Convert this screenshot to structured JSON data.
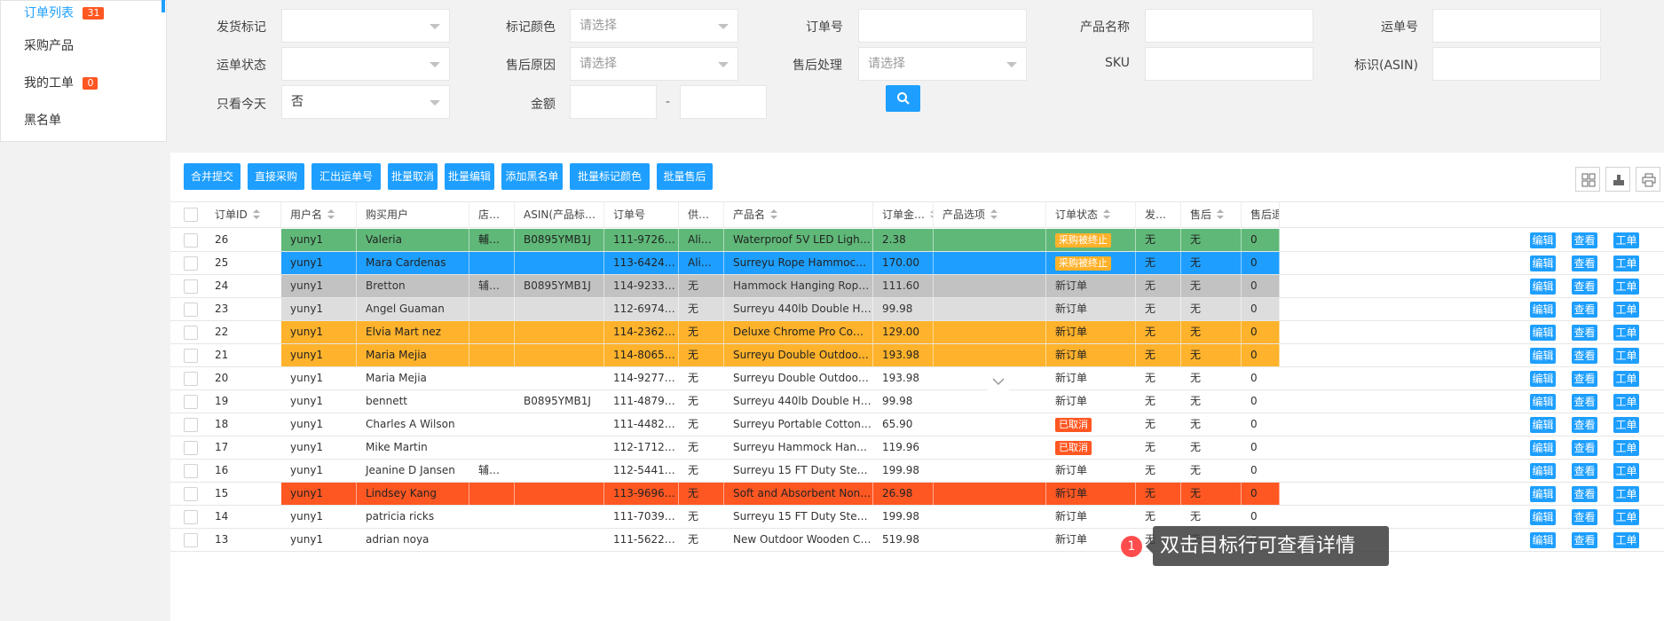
{
  "sidebar": {
    "items": [
      {
        "label": "订单列表",
        "badge": "31"
      },
      {
        "label": "采购产品",
        "badge": ""
      },
      {
        "label": "我的工单",
        "badge": "0"
      },
      {
        "label": "黑名单",
        "badge": ""
      }
    ]
  },
  "filters": {
    "ship_mark": {
      "label": "发货标记",
      "value": ""
    },
    "mark_color": {
      "label": "标记颜色",
      "placeholder": "请选择"
    },
    "order_no": {
      "label": "订单号",
      "value": ""
    },
    "product_name": {
      "label": "产品名称",
      "value": ""
    },
    "tracking_no": {
      "label": "运单号",
      "value": ""
    },
    "ship_status": {
      "label": "运单状态",
      "value": ""
    },
    "aftersale_reason": {
      "label": "售后原因",
      "placeholder": "请选择"
    },
    "aftersale_handling": {
      "label": "售后处理",
      "placeholder": "请选择"
    },
    "sku": {
      "label": "SKU",
      "value": ""
    },
    "asin": {
      "label": "标识(ASIN)",
      "value": ""
    },
    "today_only": {
      "label": "只看今天",
      "value": "否"
    },
    "amount": {
      "label": "金额",
      "separator": "-"
    }
  },
  "toolbar": {
    "buttons": [
      "合并提交",
      "直接采购",
      "汇出运单号",
      "批量取消",
      "批量编辑",
      "添加黑名单",
      "批量标记颜色",
      "批量售后"
    ]
  },
  "table": {
    "headers": [
      "订单ID",
      "用户名",
      "购买用户",
      "店…",
      "ASIN(产品标…",
      "订单号",
      "供…",
      "产品名",
      "订单金…",
      "产品选项",
      "订单状态",
      "发…",
      "售后",
      "售后退"
    ],
    "action_labels": [
      "编辑",
      "查看",
      "工单"
    ],
    "rows": [
      {
        "id": "26",
        "user": "yuny1",
        "buyer": "Valeria",
        "store": "輔…",
        "asin": "B0895YMB1J",
        "order_no": "111-97267…",
        "supplier": "Ali…",
        "product": "Waterproof 5V LED Light Stri…",
        "amount": "2.38",
        "options": "",
        "status": "采购被终止",
        "ship": "无",
        "aftersale": "无",
        "refund": "0"
      },
      {
        "id": "25",
        "user": "yuny1",
        "buyer": "Mara Cardenas",
        "store": "",
        "asin": "",
        "order_no": "113-64246…",
        "supplier": "Ali…",
        "product": "Surreyu Rope Hammock 55\" …",
        "amount": "170.00",
        "options": "",
        "status": "采购被终止",
        "ship": "无",
        "aftersale": "无",
        "refund": "0"
      },
      {
        "id": "24",
        "user": "yuny1",
        "buyer": "Bretton",
        "store": "辅…",
        "asin": "B0895YMB1J",
        "order_no": "114-92335…",
        "supplier": "无",
        "product": "Hammock Hanging Rope Ch…",
        "amount": "111.60",
        "options": "",
        "status": "新订单",
        "ship": "无",
        "aftersale": "无",
        "refund": "0"
      },
      {
        "id": "23",
        "user": "yuny1",
        "buyer": "Angel Guaman",
        "store": "",
        "asin": "",
        "order_no": "112-69749…",
        "supplier": "无",
        "product": "Surreyu 440lb Double Hamm…",
        "amount": "99.98",
        "options": "",
        "status": "新订单",
        "ship": "无",
        "aftersale": "无",
        "refund": "0"
      },
      {
        "id": "22",
        "user": "yuny1",
        "buyer": "Elvia Mart nez",
        "store": "",
        "asin": "",
        "order_no": "114-23624…",
        "supplier": "无",
        "product": "Deluxe Chrome Pro Complet…",
        "amount": "129.00",
        "options": "",
        "status": "新订单",
        "ship": "无",
        "aftersale": "无",
        "refund": "0"
      },
      {
        "id": "21",
        "user": "yuny1",
        "buyer": "Maria Mejia",
        "store": "",
        "asin": "",
        "order_no": "114-80652…",
        "supplier": "无",
        "product": "Surreyu Double Outdoor Swi…",
        "amount": "193.98",
        "options": "",
        "status": "新订单",
        "ship": "无",
        "aftersale": "无",
        "refund": "0"
      },
      {
        "id": "20",
        "user": "yuny1",
        "buyer": "Maria Mejia",
        "store": "",
        "asin": "",
        "order_no": "114-92772…",
        "supplier": "无",
        "product": "Surreyu Double Outdoor Swi…",
        "amount": "193.98",
        "options": "",
        "status": "新订单",
        "ship": "无",
        "aftersale": "无",
        "refund": "0"
      },
      {
        "id": "19",
        "user": "yuny1",
        "buyer": "bennett",
        "store": "",
        "asin": "B0895YMB1J",
        "order_no": "111-48797…",
        "supplier": "无",
        "product": "Surreyu 440lb Double Hamm…",
        "amount": "99.98",
        "options": "",
        "status": "新订单",
        "ship": "无",
        "aftersale": "无",
        "refund": "0"
      },
      {
        "id": "18",
        "user": "yuny1",
        "buyer": "Charles A Wilson",
        "store": "",
        "asin": "",
        "order_no": "111-44828…",
        "supplier": "无",
        "product": "Surreyu Portable Cotton Rop…",
        "amount": "65.90",
        "options": "",
        "status": "已取消",
        "ship": "无",
        "aftersale": "无",
        "refund": "0"
      },
      {
        "id": "17",
        "user": "yuny1",
        "buyer": "Mike Martin",
        "store": "",
        "asin": "",
        "order_no": "112-17125…",
        "supplier": "无",
        "product": "Surreyu Hammock Hanging …",
        "amount": "119.96",
        "options": "",
        "status": "已取消",
        "ship": "无",
        "aftersale": "无",
        "refund": "0"
      },
      {
        "id": "16",
        "user": "yuny1",
        "buyer": "Jeanine D Jansen",
        "store": "辅…",
        "asin": "",
        "order_no": "112-54419…",
        "supplier": "无",
        "product": "Surreyu 15 FT Duty Steel Ha…",
        "amount": "199.98",
        "options": "",
        "status": "新订单",
        "ship": "无",
        "aftersale": "无",
        "refund": "0"
      },
      {
        "id": "15",
        "user": "yuny1",
        "buyer": "Lindsey Kang",
        "store": "",
        "asin": "",
        "order_no": "113-96964…",
        "supplier": "无",
        "product": "Soft and Absorbent Non-Wov…",
        "amount": "26.98",
        "options": "",
        "status": "新订单",
        "ship": "无",
        "aftersale": "无",
        "refund": "0"
      },
      {
        "id": "14",
        "user": "yuny1",
        "buyer": "patricia ricks",
        "store": "",
        "asin": "",
        "order_no": "111-70396…",
        "supplier": "无",
        "product": "Surreyu 15 FT Duty Steel Ha…",
        "amount": "199.98",
        "options": "",
        "status": "新订单",
        "ship": "无",
        "aftersale": "无",
        "refund": "0"
      },
      {
        "id": "13",
        "user": "yuny1",
        "buyer": "adrian noya",
        "store": "",
        "asin": "",
        "order_no": "111-56229…",
        "supplier": "无",
        "product": "New Outdoor Wooden Curve…",
        "amount": "519.98",
        "options": "",
        "status": "新订单",
        "ship": "无",
        "aftersale": "无",
        "refund": "0"
      }
    ]
  },
  "row_colors": {
    "green": "#5fb878",
    "blue": "#1e9fff",
    "gray": "#c2c2c2",
    "lightgray": "#dddddd",
    "orange": "#ffb22b",
    "red": "#ff5722"
  },
  "status_colors": {
    "采购被终止": "#ffb22b",
    "已取消": "#ff5722"
  },
  "tooltip": {
    "number": "1",
    "text": "双击目标行可查看详情"
  }
}
